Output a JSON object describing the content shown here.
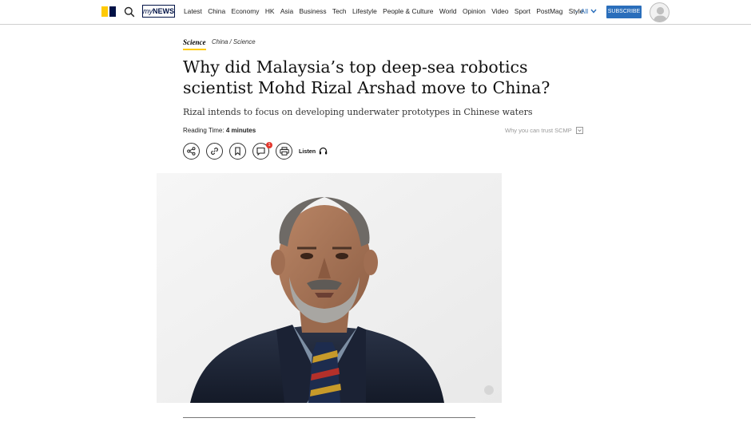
{
  "header": {
    "mynews_prefix": "my",
    "mynews_suffix": "NEWS",
    "nav_items": [
      "Latest",
      "China",
      "Economy",
      "HK",
      "Asia",
      "Business",
      "Tech",
      "Lifestyle",
      "People & Culture",
      "World",
      "Opinion",
      "Video",
      "Sport",
      "PostMag",
      "Style"
    ],
    "all_label": "All",
    "subscribe_label": "SUBSCRIBE",
    "logo_colors": {
      "yellow": "#ffca05",
      "navy": "#001246"
    },
    "icons": {
      "search": "search-icon",
      "avatar": "user-avatar-icon",
      "chevron": "chevron-down-icon"
    }
  },
  "article": {
    "section": "Science",
    "breadcrumb": "China / Science",
    "headline": "Why did Malaysia’s top deep-sea robotics scientist Mohd Rizal Arshad move to China?",
    "subhead": "Rizal intends to focus on developing underwater prototypes in Chinese waters",
    "reading_time_label": "Reading Time:",
    "reading_time_value": "4 minutes",
    "trust_label": "Why you can trust SCMP",
    "comment_count": "1",
    "listen_label": "Listen",
    "action_icons": [
      "share-icon",
      "link-icon",
      "bookmark-icon",
      "comment-icon",
      "print-icon"
    ]
  },
  "colors": {
    "accent": "#2a6ebb",
    "section_underline": "#ffca05",
    "badge": "#e4372d"
  }
}
